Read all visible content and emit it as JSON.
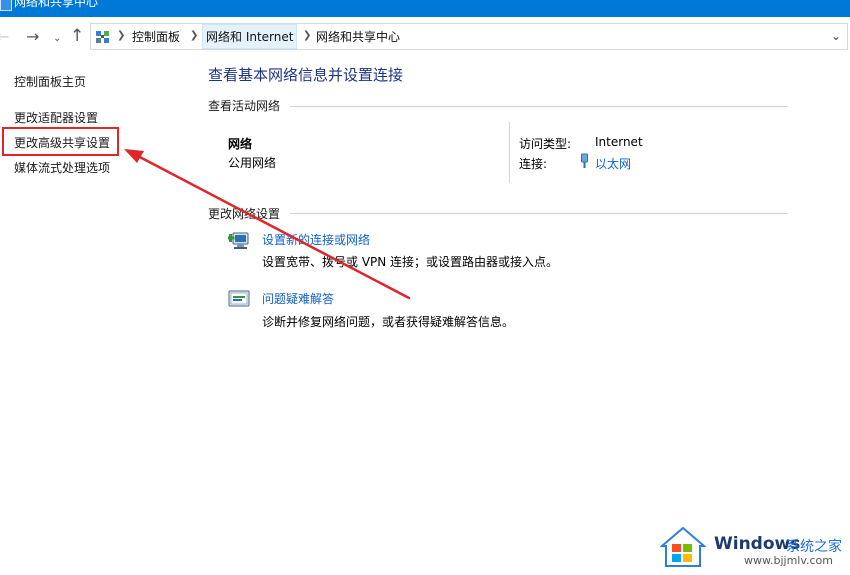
{
  "window": {
    "title": "网络和共享中心"
  },
  "address_bar": {
    "crumbs": [
      "控制面板",
      "网络和 Internet",
      "网络和共享中心"
    ]
  },
  "sidebar": {
    "items": [
      {
        "label": "控制面板主页"
      },
      {
        "label": "更改适配器设置"
      },
      {
        "label": "更改高级共享设置"
      },
      {
        "label": "媒体流式处理选项"
      }
    ]
  },
  "main": {
    "title": "查看基本网络信息并设置连接",
    "active_networks_heading": "查看活动网络",
    "network": {
      "name": "网络",
      "type": "公用网络",
      "access_type_label": "访问类型:",
      "access_type_value": "Internet",
      "connections_label": "连接:",
      "connections_value": "以太网"
    },
    "change_settings_heading": "更改网络设置",
    "tasks": [
      {
        "title": "设置新的连接或网络",
        "desc": "设置宽带、拨号或 VPN 连接；或设置路由器或接入点。",
        "icon": "new-connection-icon"
      },
      {
        "title": "问题疑难解答",
        "desc": "诊断并修复网络问题，或者获得疑难解答信息。",
        "icon": "troubleshoot-icon"
      }
    ]
  },
  "watermark": {
    "title": "Windows",
    "subtitle": "系统之家",
    "url": "www.bjjmlv.com"
  },
  "colors": {
    "titlebar": "#0078d7",
    "link": "#1160c8",
    "heading": "#1e3287",
    "annotation": "#e0262b"
  }
}
